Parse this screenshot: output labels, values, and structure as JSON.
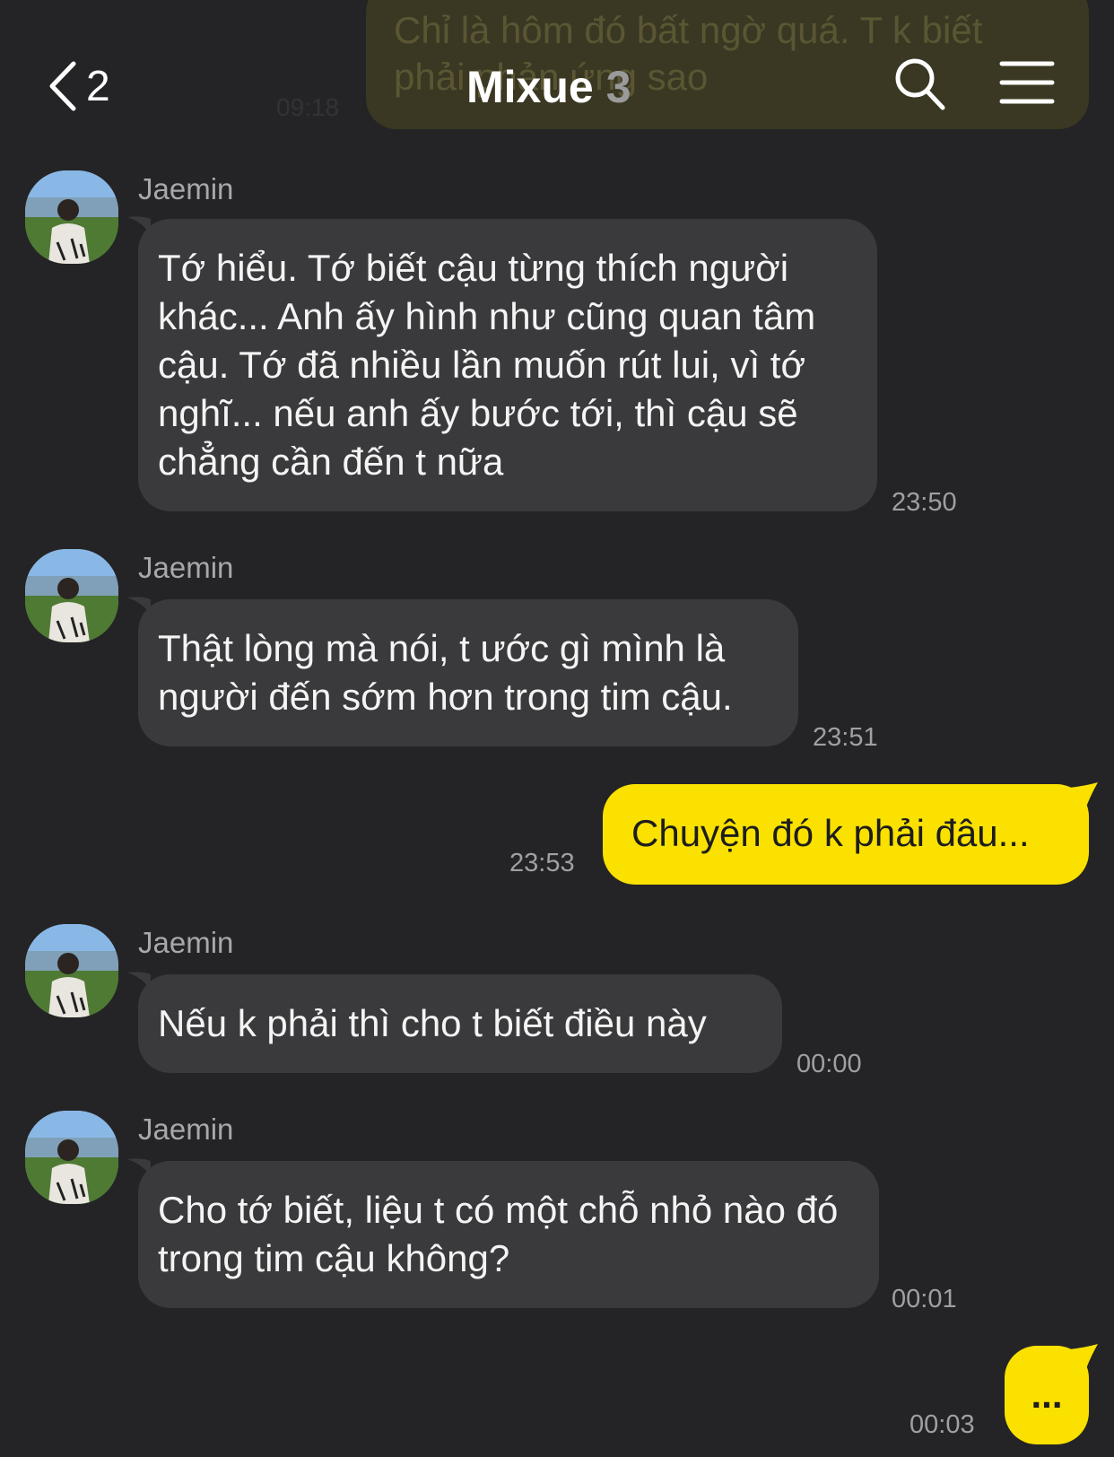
{
  "header": {
    "back_count": "2",
    "title": "Mixue",
    "member_count": "3"
  },
  "faded_previous": {
    "text": "Chỉ là hôm đó bất ngờ quá. T k biết\nphải phản ứng sao",
    "time": "09:18"
  },
  "messages": [
    {
      "sender": "Jaemin",
      "text": "Tớ hiểu. Tớ biết cậu từng thích người khác... Anh ấy hình như cũng quan tâm cậu. Tớ đã nhiều lần muốn rút lui, vì tớ nghĩ... nếu anh ấy bước tới, thì cậu sẽ chẳng cần đến t nữa",
      "time": "23:50"
    },
    {
      "sender": "Jaemin",
      "text": "Thật lòng mà nói, t ước gì mình là người đến sớm hơn trong tim cậu.",
      "time": "23:51"
    },
    {
      "sender": "me",
      "text": "Chuyện đó k phải đâu...",
      "time": "23:53"
    },
    {
      "sender": "Jaemin",
      "text": "Nếu k phải thì cho t biết điều này",
      "time": "00:00"
    },
    {
      "sender": "Jaemin",
      "text": "Cho tớ biết, liệu t có một chỗ nhỏ nào đó trong tim cậu không?",
      "time": "00:01"
    },
    {
      "sender": "me",
      "text": "...",
      "time": "00:03"
    }
  ],
  "icons": {
    "back": "chevron-left-icon",
    "search": "search-icon",
    "menu": "hamburger-menu-icon",
    "avatar": "profile-photo"
  },
  "colors": {
    "background": "#242426",
    "incoming_bubble": "#3a3a3c",
    "outgoing_bubble": "#fae100",
    "sender_name": "#a8a8aa",
    "timestamp": "#a0a0a2"
  }
}
